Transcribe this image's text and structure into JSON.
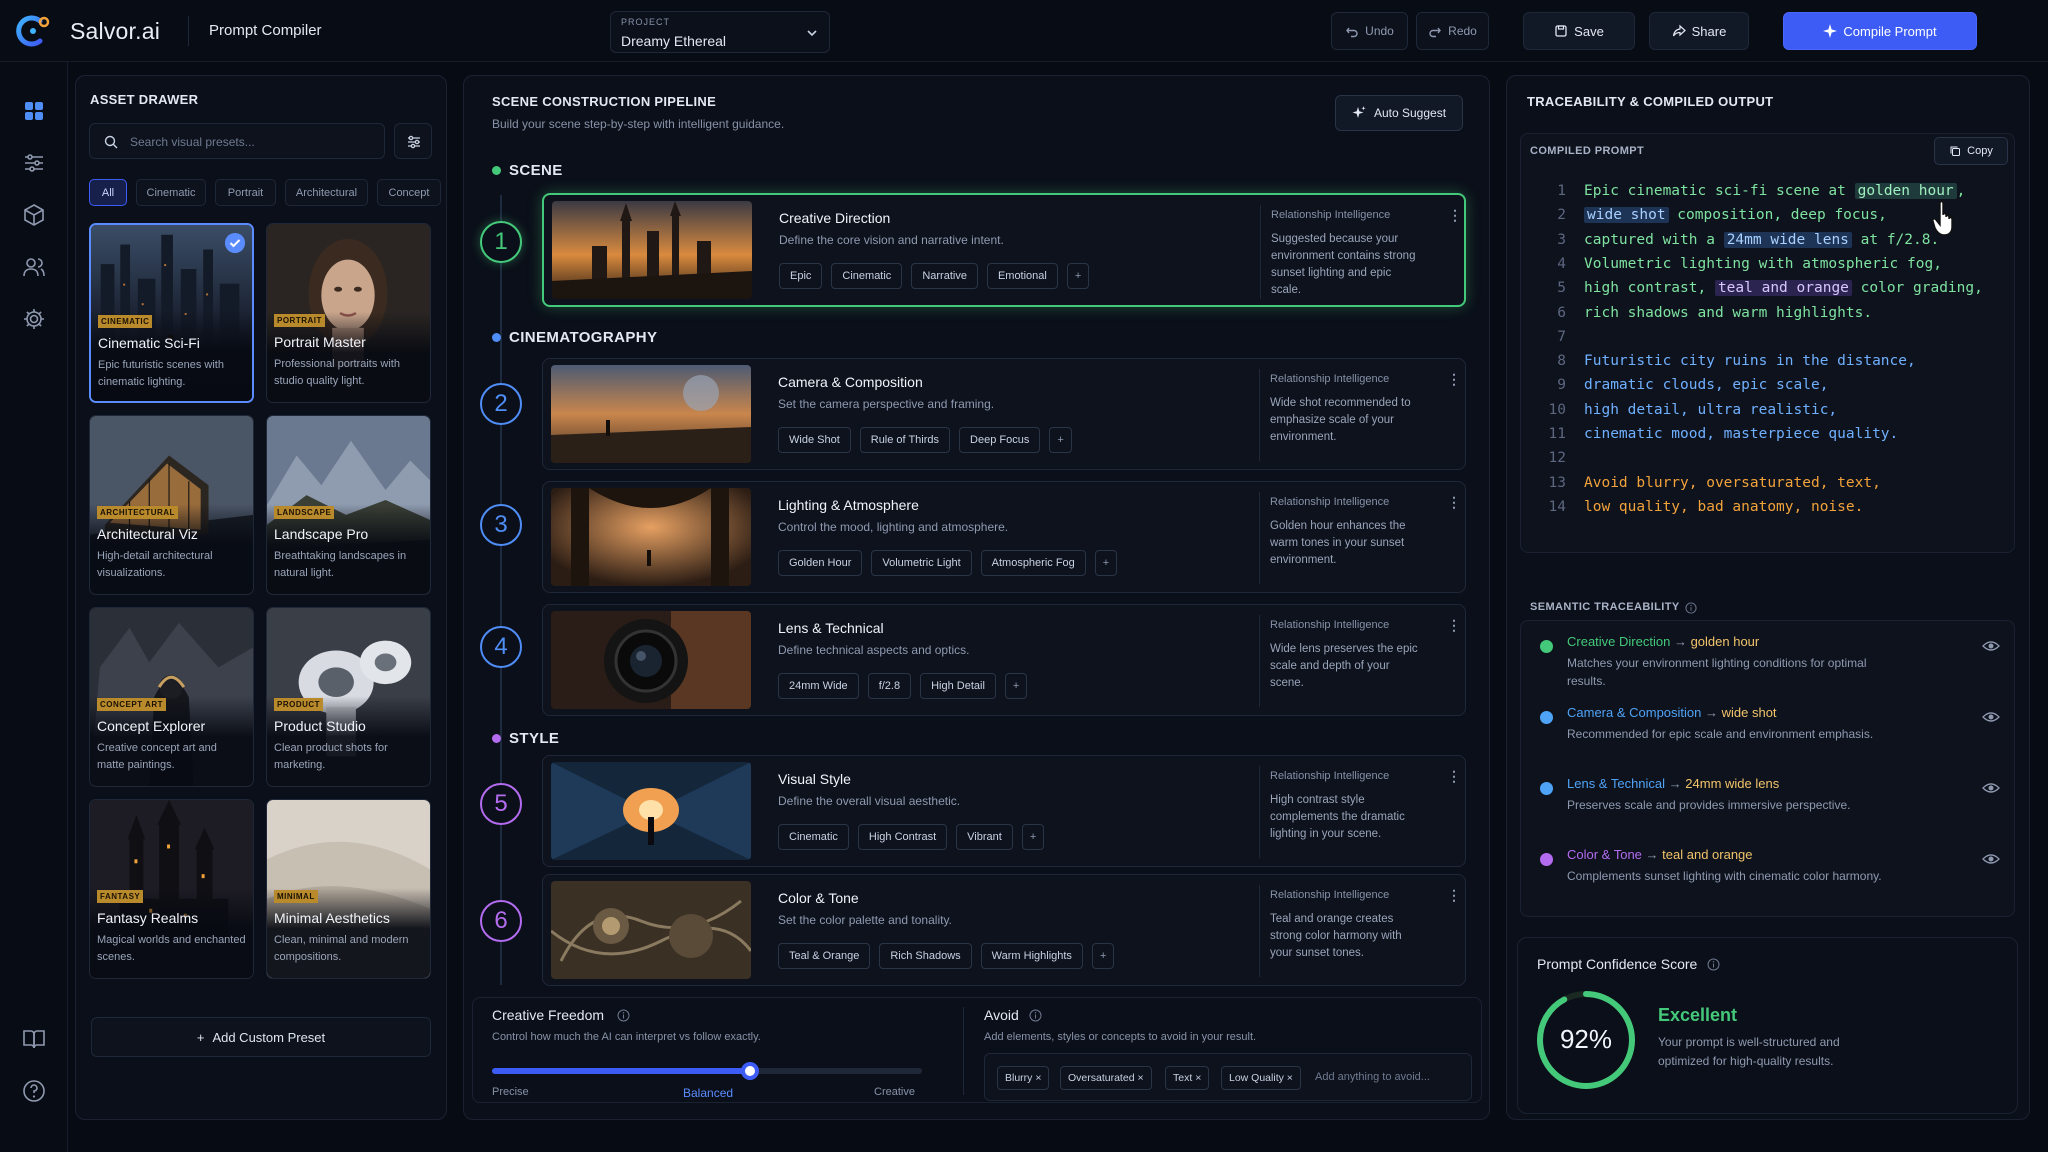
{
  "app": {
    "name": "Salvor.ai",
    "page": "Prompt Compiler"
  },
  "project": {
    "label": "PROJECT",
    "value": "Dreamy Ethereal"
  },
  "toolbar": {
    "undo": "Undo",
    "redo": "Redo",
    "save": "Save",
    "share": "Share",
    "compile": "Compile Prompt"
  },
  "colors": {
    "accent": "#3d5cf5",
    "scene": "#44c97a",
    "cinematography": "#4f8df7",
    "style": "#b36cf0",
    "gold": "#f2a23a"
  },
  "nav": {
    "icons": [
      "grid-icon",
      "sliders-icon",
      "cube-icon",
      "users-icon",
      "gear-icon",
      "book-icon",
      "help-icon"
    ]
  },
  "drawer": {
    "title": "ASSET DRAWER",
    "search_placeholder": "Search visual presets...",
    "chips": [
      "All",
      "Cinematic",
      "Portrait",
      "Architectural",
      "Concept"
    ],
    "cards": [
      {
        "tag": "CINEMATIC",
        "title": "Cinematic Sci-Fi",
        "desc": "Epic futuristic scenes with cinematic lighting."
      },
      {
        "tag": "PORTRAIT",
        "title": "Portrait Master",
        "desc": "Professional portraits with studio quality light."
      },
      {
        "tag": "ARCHITECTURAL",
        "title": "Architectural Viz",
        "desc": "High-detail architectural visualizations."
      },
      {
        "tag": "LANDSCAPE",
        "title": "Landscape Pro",
        "desc": "Breathtaking landscapes in natural light."
      },
      {
        "tag": "CONCEPT ART",
        "title": "Concept Explorer",
        "desc": "Creative concept art and matte paintings."
      },
      {
        "tag": "PRODUCT",
        "title": "Product Studio",
        "desc": "Clean product shots for marketing."
      },
      {
        "tag": "FANTASY",
        "title": "Fantasy Realms",
        "desc": "Magical worlds and enchanted scenes."
      },
      {
        "tag": "MINIMAL",
        "title": "Minimal Aesthetics",
        "desc": "Clean, minimal and modern compositions."
      }
    ],
    "add_preset": "Add Custom Preset"
  },
  "pipeline": {
    "title": "SCENE CONSTRUCTION PIPELINE",
    "subtitle": "Build your scene step-by-step with intelligent guidance.",
    "auto_suggest": "Auto Suggest",
    "sections": [
      "SCENE",
      "CINEMATOGRAPHY",
      "STYLE"
    ],
    "ri_label": "Relationship Intelligence",
    "steps": [
      {
        "num": "1",
        "title": "Creative Direction",
        "desc": "Define the core vision and narrative intent.",
        "tags": [
          "Epic",
          "Cinematic",
          "Narrative",
          "Emotional"
        ],
        "ri": "Suggested because your environment contains strong sunset lighting and epic scale."
      },
      {
        "num": "2",
        "title": "Camera & Composition",
        "desc": "Set the camera perspective and framing.",
        "tags": [
          "Wide Shot",
          "Rule of Thirds",
          "Deep Focus"
        ],
        "ri": "Wide shot recommended to emphasize scale of your environment."
      },
      {
        "num": "3",
        "title": "Lighting & Atmosphere",
        "desc": "Control the mood, lighting and atmosphere.",
        "tags": [
          "Golden Hour",
          "Volumetric Light",
          "Atmospheric Fog"
        ],
        "ri": "Golden hour enhances the warm tones in your sunset environment."
      },
      {
        "num": "4",
        "title": "Lens & Technical",
        "desc": "Define technical aspects and optics.",
        "tags": [
          "24mm Wide",
          "f/2.8",
          "High Detail"
        ],
        "ri": "Wide lens preserves the epic scale and depth of your scene."
      },
      {
        "num": "5",
        "title": "Visual Style",
        "desc": "Define the overall visual aesthetic.",
        "tags": [
          "Cinematic",
          "High Contrast",
          "Vibrant"
        ],
        "ri": "High contrast style complements the dramatic lighting in your scene."
      },
      {
        "num": "6",
        "title": "Color & Tone",
        "desc": "Set the color palette and tonality.",
        "tags": [
          "Teal & Orange",
          "Rich Shadows",
          "Warm Highlights"
        ],
        "ri": "Teal and orange creates strong color harmony with your sunset tones."
      }
    ]
  },
  "freedom": {
    "title": "Creative Freedom",
    "desc": "Control how much the AI can interpret vs follow exactly.",
    "min": "Precise",
    "mid": "Balanced",
    "max": "Creative",
    "value": 0.6
  },
  "avoid": {
    "title": "Avoid",
    "desc": "Add elements, styles or concepts to avoid in your result.",
    "chips": [
      "Blurry",
      "Oversaturated",
      "Text",
      "Low Quality"
    ],
    "placeholder": "Add anything to avoid..."
  },
  "output": {
    "title": "TRACEABILITY & COMPILED OUTPUT",
    "compiled_label": "COMPILED PROMPT",
    "copy": "Copy",
    "lines": [
      {
        "n": "1",
        "c": "g",
        "segs": [
          [
            "Epic cinematic sci-fi scene at ",
            ""
          ],
          [
            "golden hour",
            "hl"
          ],
          [
            ",",
            ""
          ]
        ]
      },
      {
        "n": "2",
        "c": "g",
        "segs": [
          [
            "wide shot",
            "hlb"
          ],
          [
            " composition, deep focus,",
            ""
          ]
        ]
      },
      {
        "n": "3",
        "c": "g",
        "segs": [
          [
            "captured with a ",
            ""
          ],
          [
            "24mm wide lens",
            "hlb"
          ],
          [
            " at f/2.8.",
            ""
          ]
        ]
      },
      {
        "n": "4",
        "c": "g",
        "segs": [
          [
            "Volumetric lighting with atmospheric fog,",
            ""
          ]
        ]
      },
      {
        "n": "5",
        "c": "g",
        "segs": [
          [
            "high contrast, ",
            ""
          ],
          [
            "teal and orange",
            "hlp"
          ],
          [
            " color grading,",
            ""
          ]
        ]
      },
      {
        "n": "6",
        "c": "g",
        "segs": [
          [
            "rich shadows and warm highlights.",
            ""
          ]
        ]
      },
      {
        "n": "7",
        "c": "g",
        "segs": [
          [
            "",
            ""
          ]
        ]
      },
      {
        "n": "8",
        "c": "b",
        "segs": [
          [
            "Futuristic city ruins in the distance,",
            ""
          ]
        ]
      },
      {
        "n": "9",
        "c": "b",
        "segs": [
          [
            "dramatic clouds, epic scale,",
            ""
          ]
        ]
      },
      {
        "n": "10",
        "c": "b",
        "segs": [
          [
            "high detail, ultra realistic,",
            ""
          ]
        ]
      },
      {
        "n": "11",
        "c": "b",
        "segs": [
          [
            "cinematic mood, masterpiece quality.",
            ""
          ]
        ]
      },
      {
        "n": "12",
        "c": "b",
        "segs": [
          [
            "",
            ""
          ]
        ]
      },
      {
        "n": "13",
        "c": "o",
        "segs": [
          [
            "Avoid blurry, oversaturated, text,",
            ""
          ]
        ]
      },
      {
        "n": "14",
        "c": "o",
        "segs": [
          [
            "low quality, bad anatomy, noise.",
            ""
          ]
        ]
      }
    ],
    "trace_label": "SEMANTIC TRACEABILITY",
    "trace": [
      {
        "from": "Creative Direction",
        "to": "golden hour",
        "txt": "Matches your environment lighting conditions for optimal results.",
        "color": "#44c97a"
      },
      {
        "from": "Camera & Composition",
        "to": "wide shot",
        "txt": "Recommended for epic scale and environment emphasis.",
        "color": "#4fa3f7"
      },
      {
        "from": "Lens & Technical",
        "to": "24mm wide lens",
        "txt": "Preserves scale and provides immersive perspective.",
        "color": "#4fa3f7"
      },
      {
        "from": "Color & Tone",
        "to": "teal and orange",
        "txt": "Complements sunset lighting with cinematic color harmony.",
        "color": "#b36cf0"
      }
    ],
    "confidence": {
      "label": "Prompt Confidence Score",
      "value": "92%",
      "fraction": 0.92,
      "rating": "Excellent",
      "desc": "Your prompt is well-structured and optimized for high-quality results."
    }
  }
}
